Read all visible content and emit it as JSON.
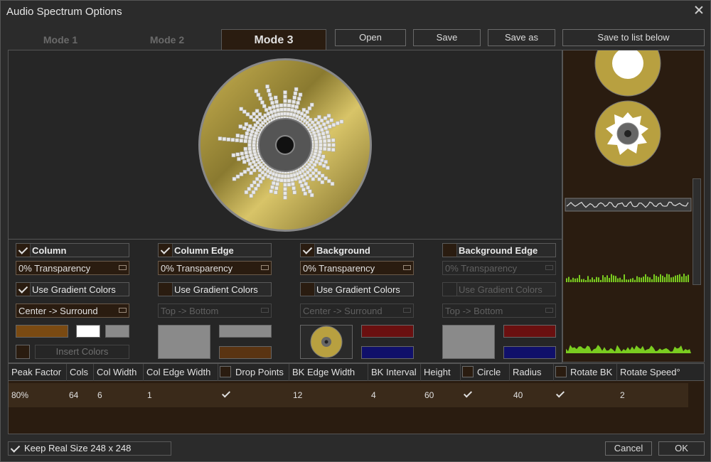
{
  "window": {
    "title": "Audio Spectrum Options",
    "close_icon": "close-icon"
  },
  "tabs": [
    {
      "label": "Mode 1",
      "active": false
    },
    {
      "label": "Mode 2",
      "active": false
    },
    {
      "label": "Mode 3",
      "active": true
    }
  ],
  "toolbar": {
    "open_label": "Open",
    "save_label": "Save",
    "save_as_label": "Save as",
    "save_to_list_label": "Save to list below"
  },
  "option_groups": [
    {
      "title": "Column",
      "enabled": true,
      "transparency": "0% Transparency",
      "use_gradient_label": "Use Gradient Colors",
      "use_gradient": true,
      "direction": "Center -> Surround",
      "direction_disabled": false,
      "colors": [
        "#7a4a12",
        "#ffffff",
        "#8a8a8a"
      ],
      "insert_colors_label": "Insert Colors"
    },
    {
      "title": "Column Edge",
      "enabled": true,
      "transparency": "0% Transparency",
      "use_gradient_label": "Use Gradient Colors",
      "use_gradient": false,
      "direction": "Top -> Bottom",
      "direction_disabled": true,
      "colors": [
        "#8a8a8a",
        "#8a8a8a",
        "#5a3412"
      ]
    },
    {
      "title": "Background",
      "enabled": true,
      "transparency": "0% Transparency",
      "use_gradient_label": "Use Gradient Colors",
      "use_gradient": false,
      "direction": "Center -> Surround",
      "direction_disabled": true,
      "colors": [
        "disc-image",
        "#6a1010",
        "#10106a"
      ]
    },
    {
      "title": "Background Edge",
      "enabled": false,
      "transparency": "0% Transparency",
      "use_gradient_label": "Use Gradient Colors",
      "use_gradient": false,
      "direction": "Top -> Bottom",
      "direction_disabled": true,
      "colors": [
        "#8a8a8a",
        "#6a1010",
        "#10106a"
      ]
    }
  ],
  "table": {
    "headers": [
      "Peak Factor",
      "Cols",
      "Col Width",
      "Col Edge Width",
      "Drop Points",
      "BK Edge Width",
      "BK Interval",
      "Height",
      "Circle",
      "Radius",
      "Rotate BK",
      "Rotate Speed°"
    ],
    "row": {
      "peak_factor": "80%",
      "cols": "64",
      "col_width": "6",
      "col_edge_width": "1",
      "drop_points": true,
      "bk_edge_width": "12",
      "bk_interval": "4",
      "height": "60",
      "circle": true,
      "radius": "40",
      "rotate_bk": true,
      "rotate_speed": "2"
    }
  },
  "footer": {
    "keep_real_size_label": "Keep Real Size 248 x 248",
    "keep_real_size": true,
    "cancel_label": "Cancel",
    "ok_label": "OK"
  },
  "colors": {
    "accent_brown": "#2a1c10",
    "disc_gold": "#b8a040",
    "spectrum_green": "#7acc20"
  }
}
